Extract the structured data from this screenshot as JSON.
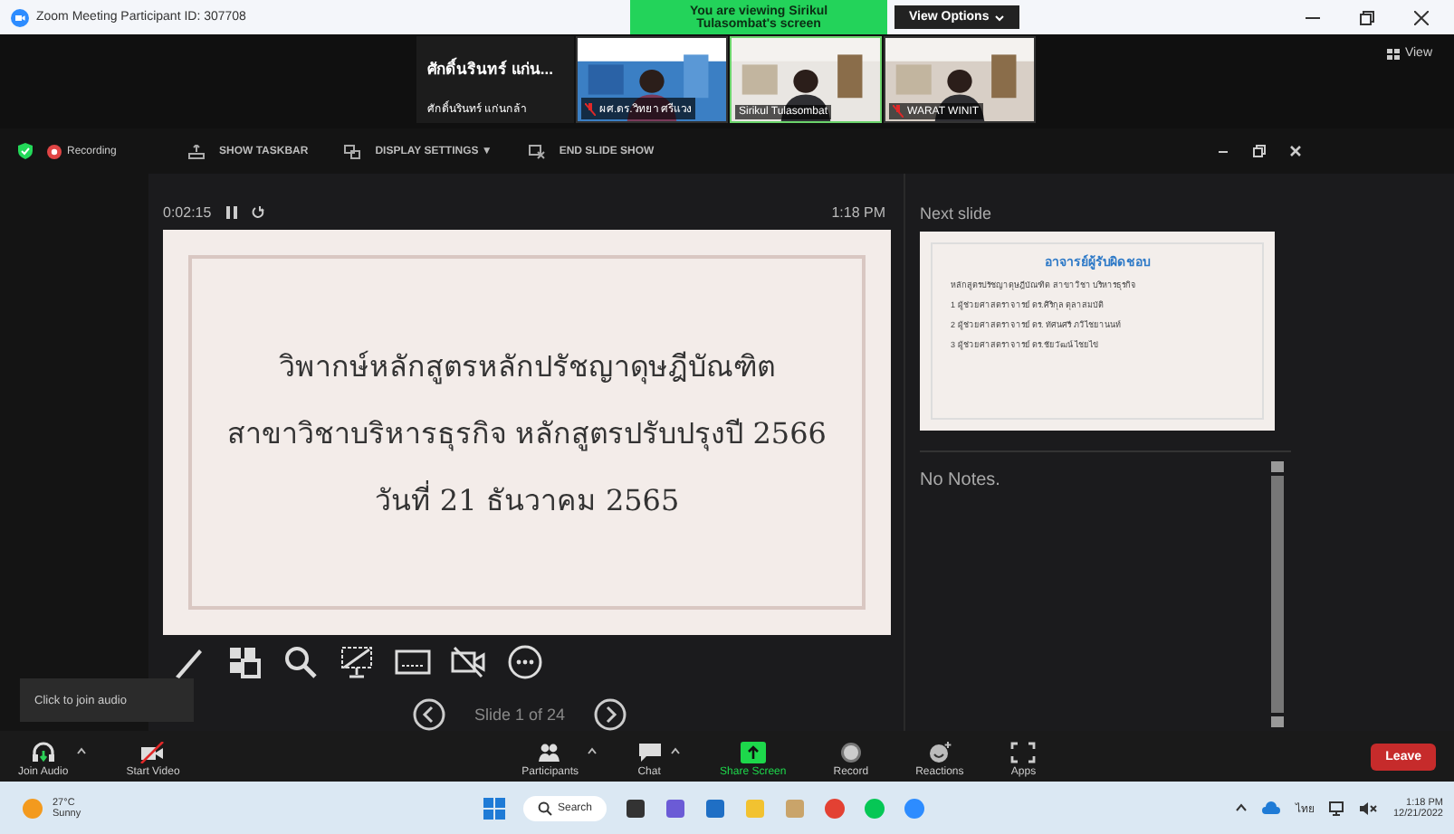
{
  "window": {
    "title": "Zoom Meeting Participant ID: 307708"
  },
  "banner": {
    "text": "You are viewing Sirikul Tulasombat's screen",
    "view_options": "View Options"
  },
  "videos": [
    {
      "kind": "name",
      "name": "ศักดิ์นรินทร์ แก่น...",
      "caption": "ศักดิ์นรินทร์ แก่นกล้า"
    },
    {
      "kind": "video",
      "caption": "ผศ.ดร.วิทยา ศรีแวง",
      "muted": true,
      "selected": false
    },
    {
      "kind": "video",
      "caption": "Sirikul Tulasombat",
      "muted": false,
      "selected": true
    },
    {
      "kind": "video",
      "caption": "WARAT WINIT",
      "muted": true,
      "selected": false
    }
  ],
  "view_button": "View",
  "recording": "Recording",
  "presenter_tools": [
    {
      "kind": "taskbar",
      "label": "SHOW TASKBAR"
    },
    {
      "kind": "display",
      "label": "DISPLAY SETTINGS ▼"
    },
    {
      "kind": "end",
      "label": "END SLIDE SHOW"
    }
  ],
  "timer": "0:02:15",
  "clock": "1:18 PM",
  "slide": {
    "lines": [
      "วิพากษ์หลักสูตรหลักปรัชญาดุษฎีบัณฑิต",
      "สาขาวิชาบริหารธุรกิจ หลักสูตรปรับปรุงปี 2566",
      "วันที่ 21 ธันวาคม 2565"
    ]
  },
  "next_slide": {
    "label": "Next slide",
    "title": "อาจารย์ผู้รับผิดชอบ",
    "lines": [
      "หลักสูตรปรัชญาดุษฎีบัณฑิต สาขาวิชา บริหารธุรกิจ",
      "1 ผู้ช่วยศาสตราจารย์ ดร.ศิริกุล ตุลาสมบัติ",
      "2 ผู้ช่วยศาสตราจารย์ ดร. ทัศนศรี ภวิไชยานนท์",
      "3 ผู้ช่วยศาสตราจารย์ ดร.ชัยวัฒน์ ไชยไข่"
    ]
  },
  "notes": "No Notes.",
  "slide_tools": [
    {
      "kind": "pen"
    },
    {
      "kind": "grid"
    },
    {
      "kind": "zoom"
    },
    {
      "kind": "screen"
    },
    {
      "kind": "subtitles"
    },
    {
      "kind": "camera"
    },
    {
      "kind": "more"
    }
  ],
  "slide_nav": "Slide 1 of 24",
  "tooltip": "Click to join audio",
  "toolbar": [
    {
      "kind": "audio",
      "label": "Join Audio",
      "caret": true,
      "active": false
    },
    {
      "kind": "video",
      "label": "Start Video",
      "caret": false,
      "active": false
    },
    {
      "kind": "spacer"
    },
    {
      "kind": "participants",
      "label": "Participants",
      "caret": true,
      "active": false
    },
    {
      "kind": "chat",
      "label": "Chat",
      "caret": true,
      "active": false
    },
    {
      "kind": "share",
      "label": "Share Screen",
      "caret": false,
      "active": true
    },
    {
      "kind": "record",
      "label": "Record",
      "caret": false,
      "active": false
    },
    {
      "kind": "reactions",
      "label": "Reactions",
      "caret": false,
      "active": false
    },
    {
      "kind": "apps",
      "label": "Apps",
      "caret": false,
      "active": false
    },
    {
      "kind": "spacer"
    }
  ],
  "leave": "Leave",
  "taskbar": {
    "temp": "27°C",
    "weather": "Sunny",
    "search": "Search",
    "apps": [
      {
        "color": "#333333"
      },
      {
        "color": "#6b5bd6"
      },
      {
        "color": "#1f6fc5"
      },
      {
        "color": "#f2c230"
      },
      {
        "color": "#c9a46a"
      },
      {
        "color": "#e34133"
      },
      {
        "color": "#06c755"
      },
      {
        "color": "#2d8cff"
      }
    ],
    "lang": "ไทย",
    "time": "1:18 PM",
    "date": "12/21/2022"
  }
}
